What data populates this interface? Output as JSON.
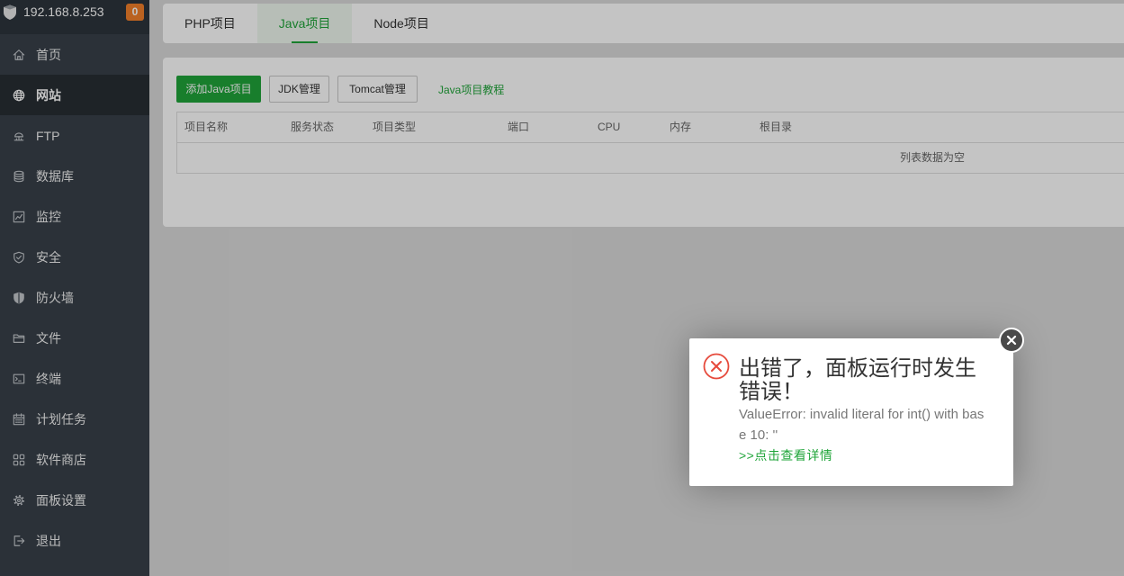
{
  "sidebar": {
    "host": "192.168.8.253",
    "badge": "0",
    "items": [
      {
        "label": "首页",
        "icon": "home-icon",
        "active": false
      },
      {
        "label": "网站",
        "icon": "globe-icon",
        "active": true
      },
      {
        "label": "FTP",
        "icon": "ftp-icon",
        "active": false
      },
      {
        "label": "数据库",
        "icon": "database-icon",
        "active": false
      },
      {
        "label": "监控",
        "icon": "monitor-icon",
        "active": false
      },
      {
        "label": "安全",
        "icon": "shield-check-icon",
        "active": false
      },
      {
        "label": "防火墙",
        "icon": "firewall-icon",
        "active": false
      },
      {
        "label": "文件",
        "icon": "folder-icon",
        "active": false
      },
      {
        "label": "终端",
        "icon": "terminal-icon",
        "active": false
      },
      {
        "label": "计划任务",
        "icon": "calendar-icon",
        "active": false
      },
      {
        "label": "软件商店",
        "icon": "grid-icon",
        "active": false
      },
      {
        "label": "面板设置",
        "icon": "gear-icon",
        "active": false
      },
      {
        "label": "退出",
        "icon": "logout-icon",
        "active": false
      }
    ]
  },
  "tabs": [
    {
      "label": "PHP项目",
      "active": false
    },
    {
      "label": "Java项目",
      "active": true
    },
    {
      "label": "Node项目",
      "active": false
    }
  ],
  "toolbar": {
    "add_label": "添加Java项目",
    "jdk_label": "JDK管理",
    "tomcat_label": "Tomcat管理",
    "tutorial_label": "Java项目教程"
  },
  "table": {
    "columns": [
      "项目名称",
      "服务状态",
      "项目类型",
      "端口",
      "CPU",
      "内存",
      "根目录"
    ],
    "empty_text": "列表数据为空"
  },
  "dialog": {
    "title": "出错了，面板运行时发生错误！",
    "message": "ValueError: invalid literal for int() with base 10: ''",
    "details_link": ">>点击查看详情",
    "icon": "error-circle-icon",
    "close_icon": "close-icon"
  },
  "colors": {
    "accent": "#20a53a",
    "error": "#e64a3c",
    "badge": "#f2802a"
  }
}
